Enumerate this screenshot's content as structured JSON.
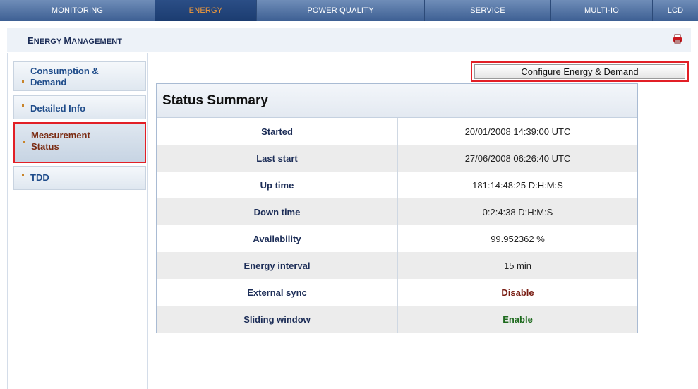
{
  "nav": {
    "tabs": [
      {
        "label": "MONITORING"
      },
      {
        "label": "ENERGY"
      },
      {
        "label": "POWER QUALITY"
      },
      {
        "label": "SERVICE"
      },
      {
        "label": "MULTI-IO"
      },
      {
        "label": "LCD"
      }
    ],
    "active_color": "#f29a3a"
  },
  "header": {
    "title_big": "E",
    "title_rest": "NERGY ",
    "title_big2": "M",
    "title_rest2": "ANAGEMENT",
    "print_icon": "printer-icon"
  },
  "sidebar": {
    "items": [
      {
        "label_line1": "Consumption &",
        "label_line2": "Demand"
      },
      {
        "label_line1": "Detailed Info",
        "label_line2": ""
      },
      {
        "label_line1": "Measurement",
        "label_line2": "Status"
      },
      {
        "label_line1": "TDD",
        "label_line2": ""
      }
    ]
  },
  "toolbar": {
    "configure_label": "Configure Energy & Demand"
  },
  "summary": {
    "title": "Status Summary",
    "rows": [
      {
        "key": "Started",
        "value": "20/01/2008 14:39:00 UTC"
      },
      {
        "key": "Last start",
        "value": "27/06/2008 06:26:40 UTC"
      },
      {
        "key": "Up time",
        "value": "181:14:48:25 D:H:M:S"
      },
      {
        "key": "Down time",
        "value": "0:2:4:38 D:H:M:S"
      },
      {
        "key": "Availability",
        "value": "99.952362 %"
      },
      {
        "key": "Energy interval",
        "value": "15 min"
      },
      {
        "key": "External sync",
        "value": "Disable"
      },
      {
        "key": "Sliding window",
        "value": "Enable"
      }
    ]
  },
  "colors": {
    "highlight": "#e21f26",
    "disable": "#7a1e14",
    "enable": "#1e6a1e"
  }
}
